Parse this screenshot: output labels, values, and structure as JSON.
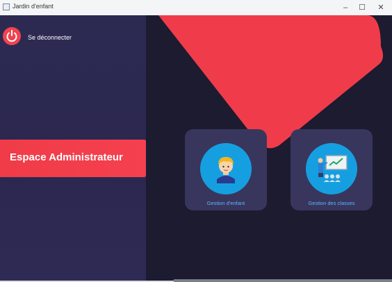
{
  "window": {
    "title": "Jardin d'enfant",
    "minimize": "–",
    "maximize": "☐",
    "close": "✕"
  },
  "sidebar": {
    "logout_label": "Se déconnecter",
    "banner": "Espace Administrateur"
  },
  "cards": [
    {
      "label": "Gestion d'enfant",
      "icon": "child-avatar-icon"
    },
    {
      "label": "Gestion des classes",
      "icon": "teacher-board-icon"
    }
  ],
  "colors": {
    "accent": "#f03b48",
    "sidebar": "#2d2a52",
    "main": "#1c1b30",
    "card": "#38365d",
    "icon_circle": "#169fe0",
    "card_label": "#5bb6ff"
  }
}
